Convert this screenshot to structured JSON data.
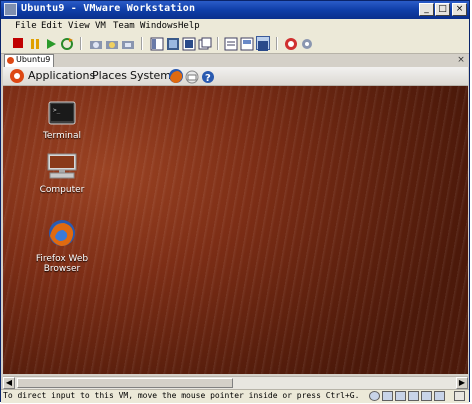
{
  "window": {
    "title": "Ubuntu9 - VMware Workstation",
    "controls": {
      "minimize": "_",
      "maximize": "□",
      "close": "×"
    }
  },
  "menu": {
    "items": [
      "File",
      "Edit",
      "View",
      "VM",
      "Team",
      "Windows",
      "Help"
    ]
  },
  "toolbar": {
    "icons": [
      "stop-icon",
      "pause-icon",
      "play-icon",
      "reset-icon",
      "snapshot-icon",
      "revert-snapshot-icon",
      "snapshot-manager-icon",
      "sidebar-icon",
      "console-icon",
      "fullscreen-icon",
      "quick-switch-icon",
      "summary-view-icon",
      "appliance-view-icon",
      "console-view-icon",
      "unity-icon",
      "settings-icon"
    ]
  },
  "tab": {
    "label": "Ubuntu9",
    "close": "×"
  },
  "guest_panel": {
    "applications": "Applications",
    "places": "Places",
    "system": "System"
  },
  "desktop_icons": [
    {
      "label": "Terminal"
    },
    {
      "label": "Computer"
    },
    {
      "label": "Firefox Web Browser"
    }
  ],
  "scrollbar": {
    "left_arrow": "◀",
    "right_arrow": "▶"
  },
  "status": {
    "text": "To direct input to this VM, move the mouse pointer inside or press Ctrl+G."
  },
  "colors": {
    "ubuntu_orange": "#dd4814",
    "title_blue": "#0f3ea8",
    "desktop_brown": "#7d2e16"
  }
}
